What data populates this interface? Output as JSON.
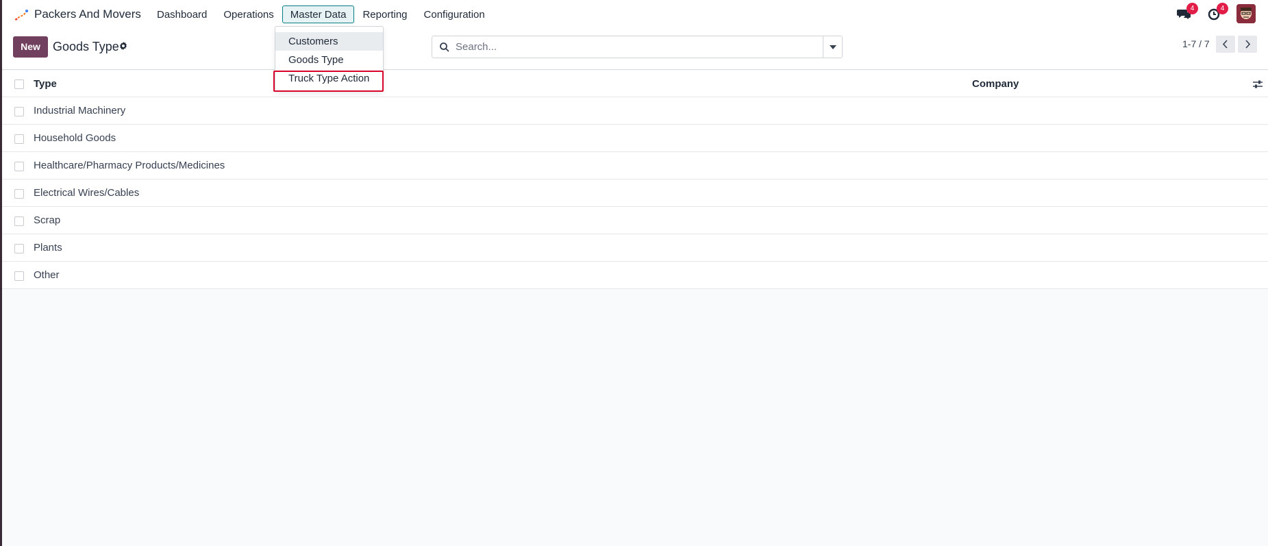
{
  "app": {
    "name": "Packers And Movers",
    "menu": [
      "Dashboard",
      "Operations",
      "Master Data",
      "Reporting",
      "Configuration"
    ],
    "active_menu": "Master Data"
  },
  "systray": {
    "messages_badge": "4",
    "activities_badge": "4"
  },
  "control": {
    "new_label": "New",
    "page_title": "Goods Type",
    "search_placeholder": "Search...",
    "pager": "1-7 / 7"
  },
  "dropdown": {
    "items": [
      "Customers",
      "Goods Type",
      "Truck Type Action"
    ]
  },
  "table": {
    "headers": {
      "type": "Type",
      "company": "Company"
    },
    "rows": [
      "Industrial Machinery",
      "Household Goods",
      "Healthcare/Pharmacy Products/Medicines",
      "Electrical Wires/Cables",
      "Scrap",
      "Plants",
      "Other"
    ]
  },
  "colors": {
    "primary": "#71405e",
    "active_menu_border": "#017e84",
    "badge": "#e11d48",
    "highlight": "#d90429"
  }
}
